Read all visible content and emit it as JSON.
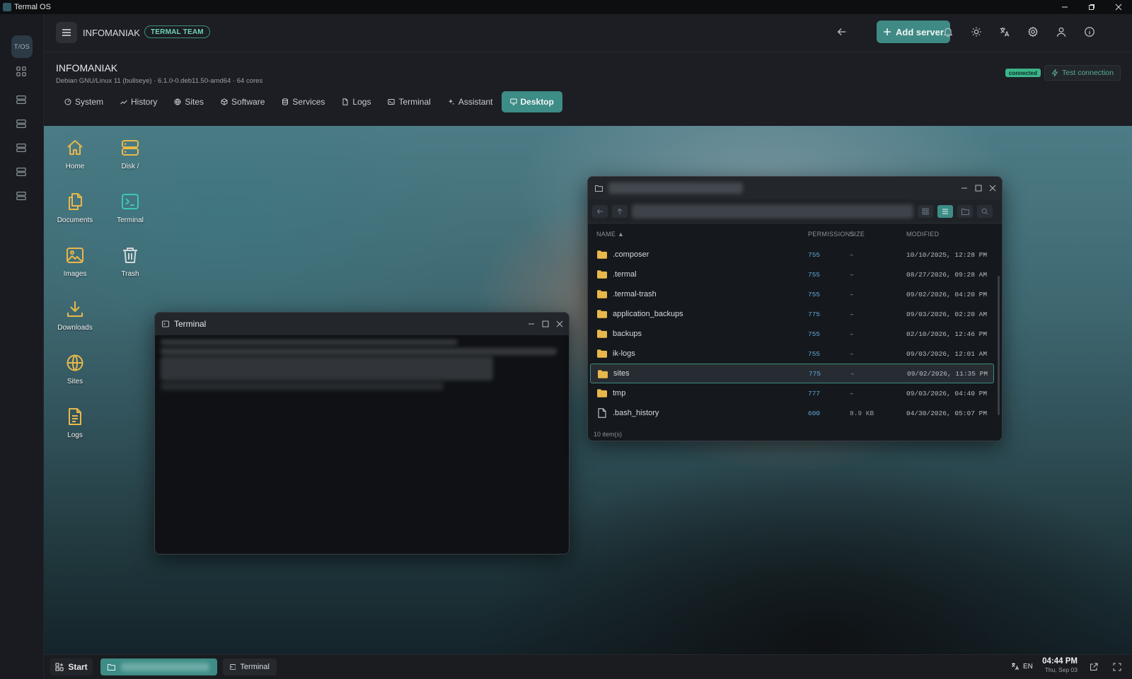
{
  "app": {
    "title": "Termal OS",
    "logo_text": "T/OS"
  },
  "topbar": {
    "server_name": "INFOMANIAK",
    "team_badge": "TERMAL TEAM",
    "add_server_label": "Add server"
  },
  "header": {
    "title": "INFOMANIAK",
    "subtitle": "Debian GNU/Linux 11 (bullseye) · 6.1.0-0.deb11.50-amd64 · 64 cores",
    "status_badge": "connected",
    "test_connection_label": "Test connection",
    "tabs": [
      {
        "label": "System",
        "icon": "gauge-icon"
      },
      {
        "label": "History",
        "icon": "chart-line-icon"
      },
      {
        "label": "Sites",
        "icon": "globe-icon"
      },
      {
        "label": "Software",
        "icon": "package-icon"
      },
      {
        "label": "Services",
        "icon": "database-icon"
      },
      {
        "label": "Logs",
        "icon": "file-icon"
      },
      {
        "label": "Terminal",
        "icon": "terminal-icon"
      },
      {
        "label": "Assistant",
        "icon": "sparkles-icon"
      },
      {
        "label": "Desktop",
        "icon": "monitor-icon",
        "active": true
      }
    ]
  },
  "desktop": {
    "icons": [
      {
        "label": "Home",
        "icon": "home-icon"
      },
      {
        "label": "Disk /",
        "icon": "disk-icon"
      },
      {
        "label": "Documents",
        "icon": "documents-icon"
      },
      {
        "label": "Terminal",
        "icon": "terminal-icon"
      },
      {
        "label": "Images",
        "icon": "image-icon"
      },
      {
        "label": "Trash",
        "icon": "trash-icon"
      },
      {
        "label": "Downloads",
        "icon": "download-icon"
      },
      {
        "label": "Sites",
        "icon": "globe-icon"
      },
      {
        "label": "Logs",
        "icon": "file-text-icon"
      }
    ],
    "accent_color": "#e8b84a"
  },
  "terminal_window": {
    "title": "Terminal"
  },
  "file_manager": {
    "columns": {
      "name": "NAME ▲",
      "permissions": "PERMISSIONS",
      "size": "SIZE",
      "modified": "MODIFIED"
    },
    "rows": [
      {
        "name": ".composer",
        "type": "folder",
        "perm": "755",
        "size": "–",
        "modified": "10/10/2025, 12:28 PM"
      },
      {
        "name": ".termal",
        "type": "folder",
        "perm": "755",
        "size": "–",
        "modified": "08/27/2026, 09:28 AM"
      },
      {
        "name": ".termal-trash",
        "type": "folder",
        "perm": "755",
        "size": "–",
        "modified": "09/02/2026, 04:20 PM"
      },
      {
        "name": "application_backups",
        "type": "folder",
        "perm": "775",
        "size": "–",
        "modified": "09/03/2026, 02:20 AM"
      },
      {
        "name": "backups",
        "type": "folder",
        "perm": "755",
        "size": "–",
        "modified": "02/10/2026, 12:46 PM"
      },
      {
        "name": "ik-logs",
        "type": "folder",
        "perm": "755",
        "size": "–",
        "modified": "09/03/2026, 12:01 AM"
      },
      {
        "name": "sites",
        "type": "folder",
        "perm": "775",
        "size": "–",
        "modified": "09/02/2026, 11:35 PM",
        "selected": true
      },
      {
        "name": "tmp",
        "type": "folder",
        "perm": "777",
        "size": "–",
        "modified": "09/03/2026, 04:40 PM"
      },
      {
        "name": ".bash_history",
        "type": "file",
        "perm": "600",
        "size": "8.9 KB",
        "modified": "04/30/2026, 05:07 PM"
      }
    ],
    "footer": "10 item(s)"
  },
  "taskbar": {
    "start_label": "Start",
    "terminal_task_label": "Terminal",
    "lang": "EN",
    "time": "04:44 PM",
    "date": "Thu, Sep 03"
  },
  "colors": {
    "accent": "#3d8c86",
    "folder": "#e8b84a",
    "perm": "#5ea8d9",
    "connected": "#3bb58a"
  }
}
